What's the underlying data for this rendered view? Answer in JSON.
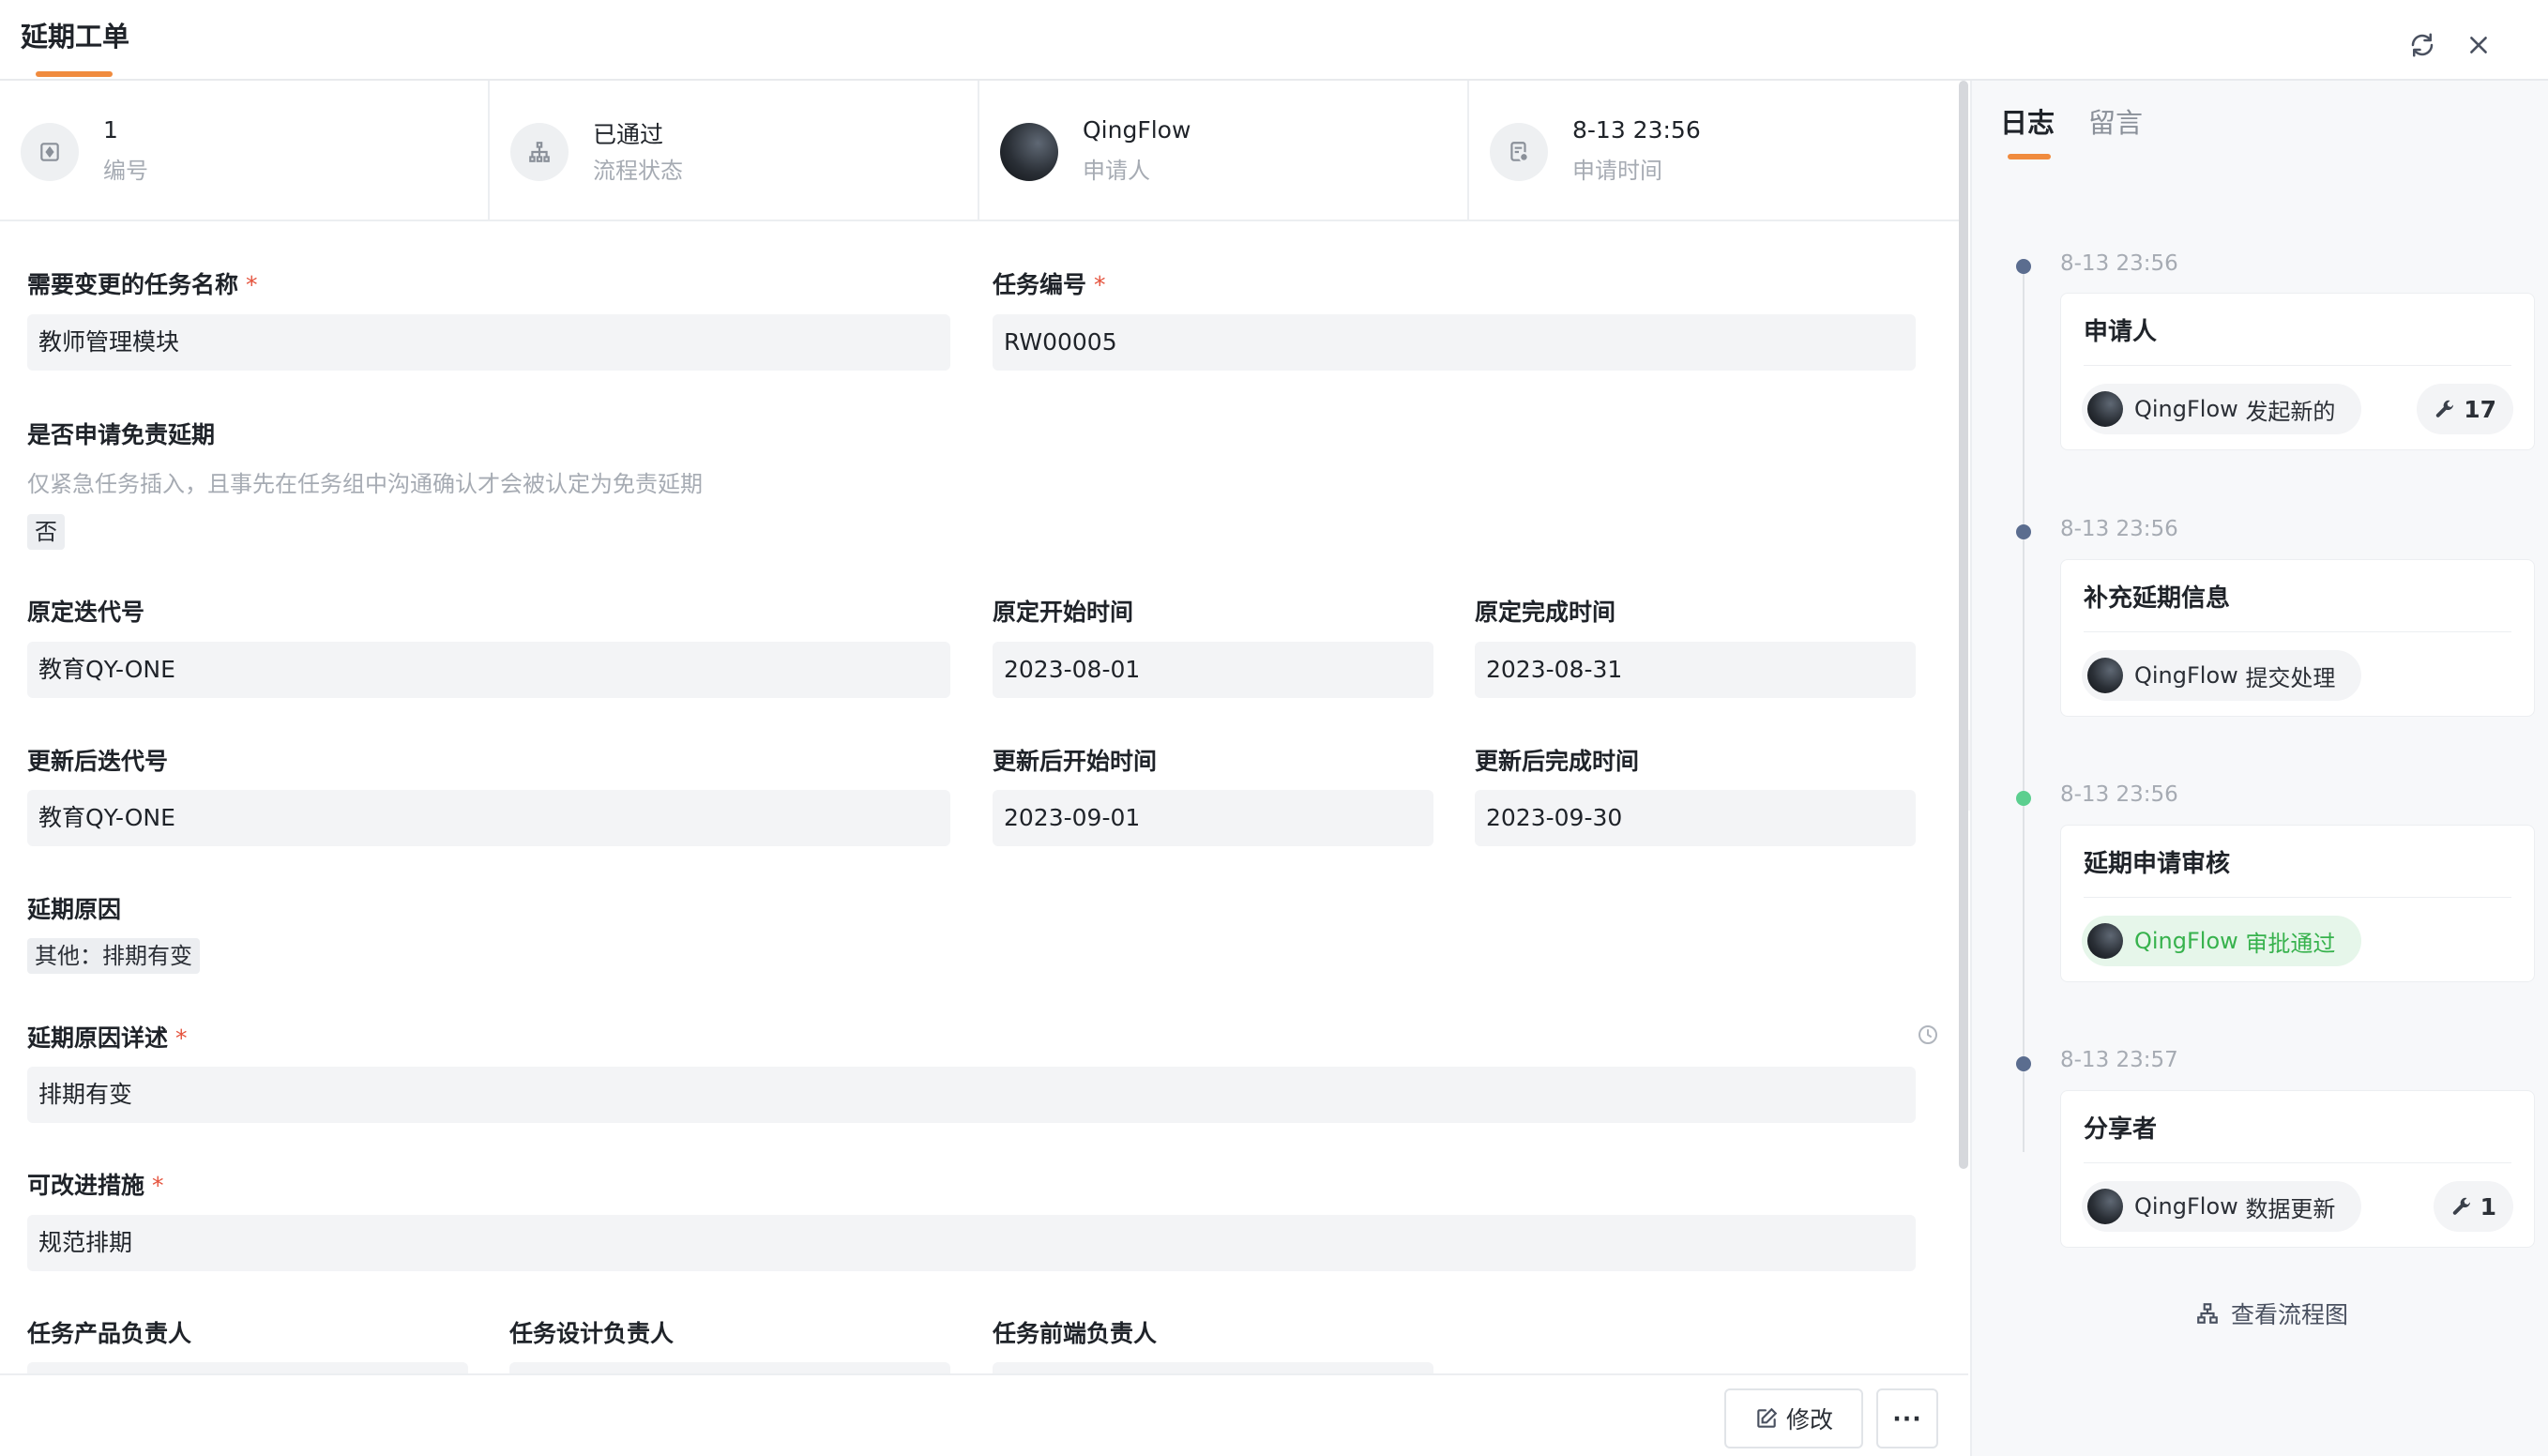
{
  "header": {
    "title": "延期工单"
  },
  "infobar": [
    {
      "value": "1",
      "label": "编号",
      "icon": "id-icon"
    },
    {
      "value": "已通过",
      "label": "流程状态",
      "icon": "workflow-icon"
    },
    {
      "value": "QingFlow",
      "label": "申请人",
      "icon": "avatar"
    },
    {
      "value": "8-13 23:56",
      "label": "申请时间",
      "icon": "clock-doc-icon"
    }
  ],
  "form": {
    "task_name": {
      "label": "需要变更的任务名称",
      "required": "*",
      "value": "教师管理模块"
    },
    "task_no": {
      "label": "任务编号",
      "required": "*",
      "value": "RW00005"
    },
    "exempt": {
      "label": "是否申请免责延期",
      "hint": "仅紧急任务插入，且事先在任务组中沟通确认才会被认定为免责延期",
      "value": "否"
    },
    "orig_iter": {
      "label": "原定迭代号",
      "value": "教育QY-ONE"
    },
    "orig_start": {
      "label": "原定开始时间",
      "value": "2023-08-01"
    },
    "orig_end": {
      "label": "原定完成时间",
      "value": "2023-08-31"
    },
    "new_iter": {
      "label": "更新后迭代号",
      "value": "教育QY-ONE"
    },
    "new_start": {
      "label": "更新后开始时间",
      "value": "2023-09-01"
    },
    "new_end": {
      "label": "更新后完成时间",
      "value": "2023-09-30"
    },
    "reason": {
      "label": "延期原因",
      "value": "其他：排期有变"
    },
    "reason_detail": {
      "label": "延期原因详述",
      "required": "*",
      "value": "排期有变"
    },
    "improve": {
      "label": "可改进措施",
      "required": "*",
      "value": "规范排期"
    },
    "owner_product": {
      "label": "任务产品负责人"
    },
    "owner_design": {
      "label": "任务设计负责人"
    },
    "owner_frontend": {
      "label": "任务前端负责人"
    }
  },
  "footer": {
    "edit_label": "修改",
    "more_label": "···"
  },
  "panel": {
    "tabs": [
      "日志",
      "留言"
    ],
    "timeline": [
      {
        "time": "8-13 23:56",
        "title": "申请人",
        "actor": "QingFlow",
        "action": "发起新的",
        "count": "17",
        "status": "default"
      },
      {
        "time": "8-13 23:56",
        "title": "补充延期信息",
        "actor": "QingFlow",
        "action": "提交处理",
        "status": "default"
      },
      {
        "time": "8-13 23:56",
        "title": "延期申请审核",
        "actor": "QingFlow",
        "action": "审批通过",
        "status": "approved"
      },
      {
        "time": "8-13 23:57",
        "title": "分享者",
        "actor": "QingFlow",
        "action": "数据更新",
        "count": "1",
        "status": "default"
      }
    ],
    "flow_link": "查看流程图"
  },
  "colors": {
    "accent": "#f08b3e",
    "required": "#e5533d",
    "approved": "#37b24d",
    "dot": "#5b6d8f",
    "dot_green": "#5ccf8f"
  }
}
